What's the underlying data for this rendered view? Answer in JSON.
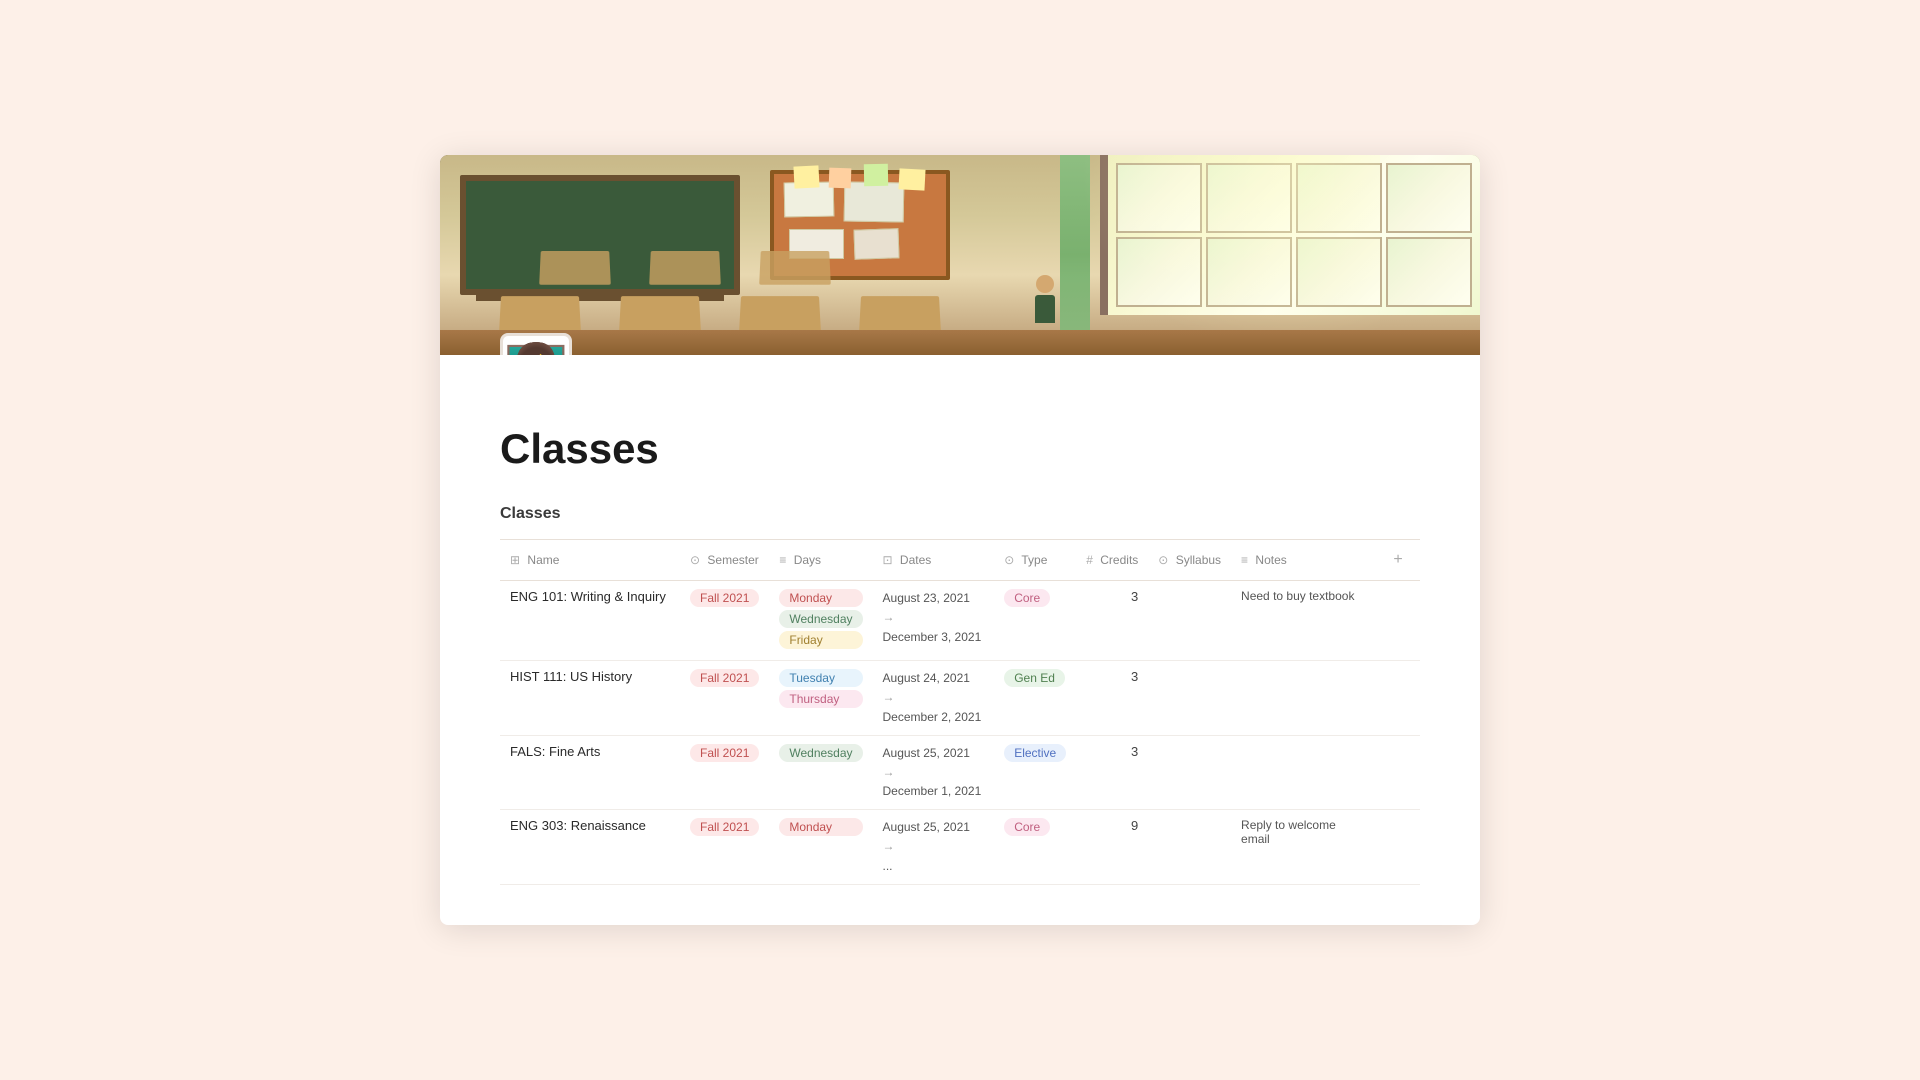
{
  "page": {
    "title": "Classes",
    "section_title": "Classes",
    "emoji": "👩‍🏫"
  },
  "table": {
    "columns": [
      {
        "id": "name",
        "label": "Name",
        "icon": "⊞"
      },
      {
        "id": "semester",
        "label": "Semester",
        "icon": "⊙"
      },
      {
        "id": "days",
        "label": "Days",
        "icon": "≡"
      },
      {
        "id": "dates",
        "label": "Dates",
        "icon": "⊡"
      },
      {
        "id": "type",
        "label": "Type",
        "icon": "⊙"
      },
      {
        "id": "credits",
        "label": "Credits",
        "icon": "#"
      },
      {
        "id": "syllabus",
        "label": "Syllabus",
        "icon": "⊙"
      },
      {
        "id": "notes",
        "label": "Notes",
        "icon": "≡"
      }
    ],
    "rows": [
      {
        "name": "ENG 101: Writing & Inquiry",
        "semester": "Fall 2021",
        "days": [
          "Monday",
          "Wednesday",
          "Friday"
        ],
        "date_start": "August 23, 2021",
        "date_end": "December 3, 2021",
        "type": "Core",
        "type_style": "core",
        "credits": "3",
        "notes": "Need to buy textbook"
      },
      {
        "name": "HIST 111: US History",
        "semester": "Fall 2021",
        "days": [
          "Tuesday",
          "Thursday"
        ],
        "date_start": "August 24, 2021",
        "date_end": "December 2, 2021",
        "type": "Gen Ed",
        "type_style": "gened",
        "credits": "3",
        "notes": ""
      },
      {
        "name": "FALS: Fine Arts",
        "semester": "Fall 2021",
        "days": [
          "Wednesday"
        ],
        "date_start": "August 25, 2021",
        "date_end": "December 1, 2021",
        "type": "Elective",
        "type_style": "elective",
        "credits": "3",
        "notes": ""
      },
      {
        "name": "ENG 303: Renaissance",
        "semester": "Fall 2021",
        "days": [
          "Monday"
        ],
        "date_start": "August 25, 2021",
        "date_end": "...",
        "type": "Core",
        "type_style": "core",
        "credits": "9",
        "notes": "Reply to welcome email"
      }
    ]
  },
  "day_styles": {
    "Monday": "day-monday",
    "Tuesday": "day-tuesday",
    "Wednesday": "day-wednesday",
    "Thursday": "day-thursday",
    "Friday": "day-friday"
  }
}
